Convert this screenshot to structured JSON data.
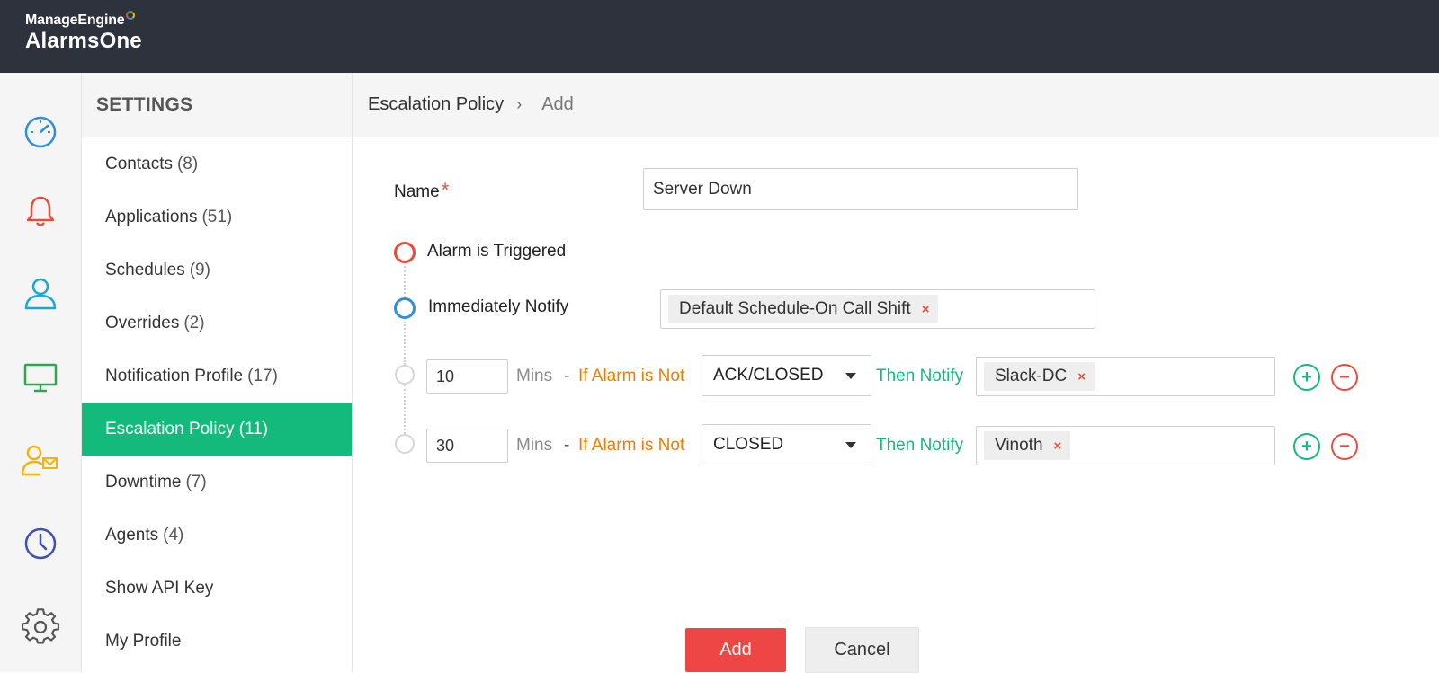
{
  "app": {
    "vendor": "ManageEngine",
    "product": "AlarmsOne"
  },
  "rail": {
    "icons": [
      "dashboard-gauge-icon",
      "alarm-bell-icon",
      "user-icon",
      "monitor-icon",
      "contact-mail-icon",
      "clock-icon",
      "gear-icon"
    ]
  },
  "sidebar": {
    "heading": "SETTINGS",
    "items": [
      {
        "label": "Contacts",
        "count": "(8)"
      },
      {
        "label": "Applications",
        "count": "(51)"
      },
      {
        "label": "Schedules",
        "count": "(9)"
      },
      {
        "label": "Overrides",
        "count": "(2)"
      },
      {
        "label": "Notification Profile",
        "count": "(17)"
      },
      {
        "label": "Escalation Policy",
        "count": "(11)"
      },
      {
        "label": "Downtime",
        "count": "(7)"
      },
      {
        "label": "Agents",
        "count": "(4)"
      },
      {
        "label": "Show API Key",
        "count": ""
      },
      {
        "label": "My Profile",
        "count": ""
      }
    ],
    "active_index": 5
  },
  "breadcrumb": {
    "parent": "Escalation Policy",
    "separator": "›",
    "current": "Add"
  },
  "form": {
    "name_label": "Name",
    "required_mark": "*",
    "name_value": "Server Down",
    "alarm_triggered": "Alarm is Triggered",
    "immediately_notify": "Immediately Notify",
    "immediate_tags": [
      "Default Schedule-On Call Shift"
    ],
    "steps": [
      {
        "mins_value": "10",
        "mins_label": "Mins",
        "dash": "-",
        "condition_label": "If Alarm is Not",
        "status": "ACK/CLOSED",
        "then_label": "Then Notify",
        "tags": [
          "Slack-DC"
        ]
      },
      {
        "mins_value": "30",
        "mins_label": "Mins",
        "dash": "-",
        "condition_label": "If Alarm is Not",
        "status": "CLOSED",
        "then_label": "Then Notify",
        "tags": [
          "Vinoth"
        ]
      }
    ],
    "tag_remove": "×",
    "add_step": "+",
    "remove_step": "−",
    "add_button": "Add",
    "cancel_button": "Cancel"
  },
  "colors": {
    "topbar": "#2d323d",
    "accent_green": "#14b97c",
    "danger_red": "#ee4545",
    "orange": "#f07d00",
    "blue": "#2f8fd8"
  }
}
